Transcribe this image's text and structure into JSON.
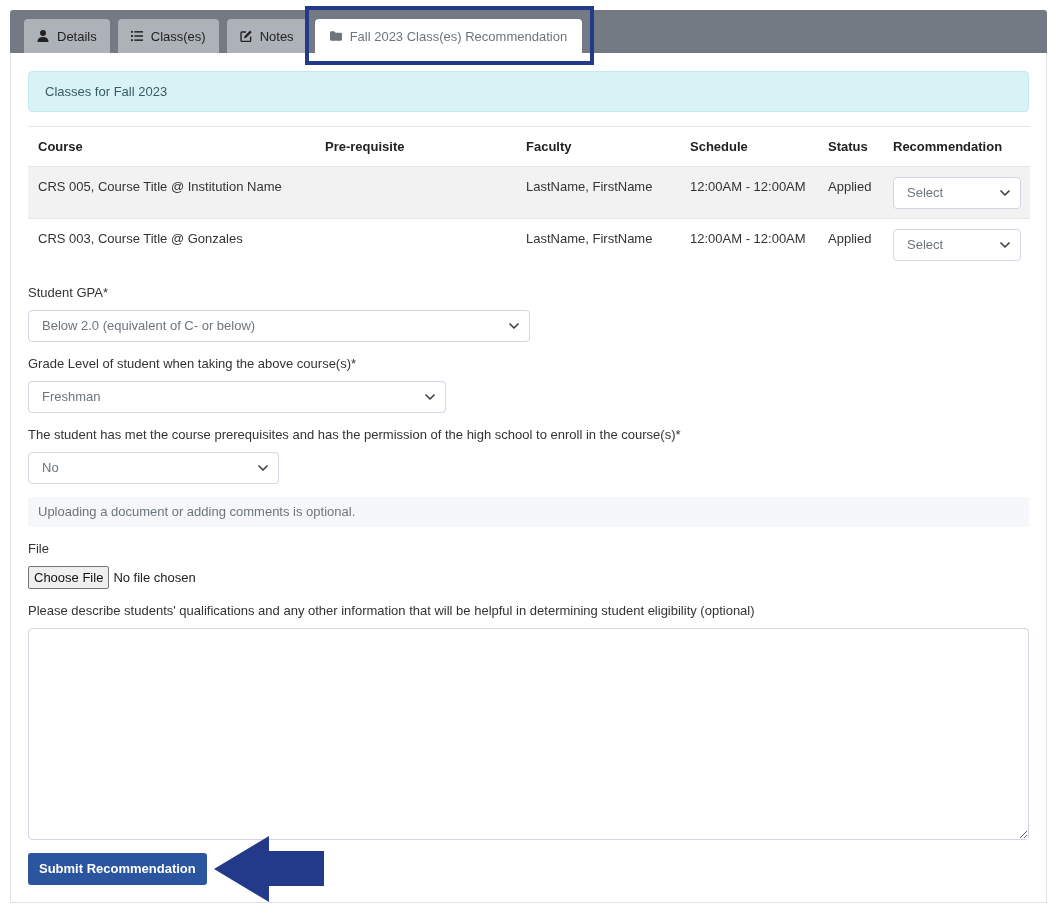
{
  "tabs": [
    {
      "label": "Details",
      "selected": false
    },
    {
      "label": "Class(es)",
      "selected": false
    },
    {
      "label": "Notes",
      "selected": false
    },
    {
      "label": "Fall 2023 Class(es) Recommendation",
      "selected": true
    }
  ],
  "alert": {
    "text": "Classes for Fall 2023"
  },
  "table": {
    "columns": [
      "Course",
      "Pre-requisite",
      "Faculty",
      "Schedule",
      "Status",
      "Recommendation"
    ],
    "rows": [
      {
        "course": "CRS 005, Course Title @ Institution Name",
        "faculty": "LastName, FirstName",
        "schedule": "12:00AM - 12:00AM",
        "status": "Applied",
        "recommendation": "Select"
      },
      {
        "course": "CRS 003, Course Title @ Gonzales",
        "faculty": "LastName, FirstName",
        "schedule": "12:00AM - 12:00AM",
        "status": "Applied",
        "recommendation": "Select"
      }
    ]
  },
  "fields": [
    {
      "kind": "select",
      "label": "Student GPA*",
      "value": "Below 2.0 (equivalent of C- or below)"
    },
    {
      "kind": "select",
      "label": "Grade Level of student when taking the above course(s)*",
      "value": "Freshman"
    },
    {
      "kind": "select",
      "label": "The student has met the course prerequisites and has the permission of the high school to enroll in the course(s)*",
      "value": "No"
    },
    {
      "kind": "note",
      "text": "Uploading a document or adding comments is optional."
    },
    {
      "kind": "file",
      "label": "File",
      "button": "Choose File",
      "status": "No file chosen"
    },
    {
      "kind": "textarea",
      "label": "Please describe students' qualifications and any other information that will be helpful in determining student eligibility (optional)"
    }
  ],
  "submit": {
    "label": "Submit Recommendation"
  }
}
